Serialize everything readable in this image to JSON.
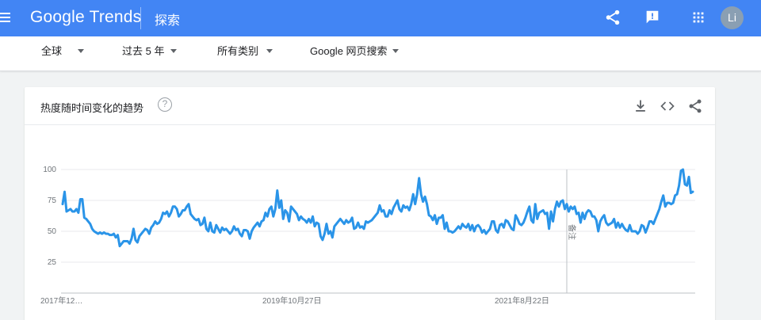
{
  "header": {
    "logo_google": "Google",
    "logo_trends": "Trends",
    "page_title": "探索",
    "avatar_initials": "Li",
    "color": "#4285f4"
  },
  "filters": {
    "region": "全球",
    "time": "过去 5 年",
    "category": "所有类别",
    "search_type": "Google 网页搜索"
  },
  "card": {
    "title": "热度随时间变化的趋势",
    "help_symbol": "?"
  },
  "icons": {
    "menu": "menu-icon",
    "share": "share-icon",
    "feedback": "feedback-icon",
    "apps": "apps-grid-icon",
    "help": "help-icon",
    "download": "download-icon",
    "embed": "embed-icon"
  },
  "chart_data": {
    "type": "line",
    "color": "#2a94e8",
    "ylim": [
      0,
      100
    ],
    "yticks": [
      25,
      50,
      75,
      100
    ],
    "xtick_labels": [
      "2017年12…",
      "2019年10月27日",
      "2021年8月22日"
    ],
    "annotation": "备注",
    "values": [
      72,
      82,
      66,
      67,
      68,
      66,
      66,
      68,
      65,
      76,
      76,
      61,
      60,
      58,
      56,
      52,
      50,
      49,
      48,
      49,
      48,
      49,
      48,
      48,
      47,
      47,
      48,
      45,
      47,
      38,
      40,
      42,
      42,
      42,
      40,
      44,
      52,
      43,
      41,
      46,
      48,
      50,
      52,
      51,
      48,
      53,
      55,
      58,
      56,
      57,
      60,
      65,
      64,
      66,
      62,
      65,
      70,
      70,
      68,
      62,
      64,
      67,
      67,
      70,
      72,
      64,
      62,
      60,
      59,
      60,
      55,
      56,
      61,
      52,
      50,
      57,
      50,
      49,
      55,
      52,
      49,
      53,
      51,
      52,
      50,
      48,
      50,
      54,
      51,
      52,
      48,
      46,
      51,
      51,
      50,
      44,
      50,
      53,
      55,
      57,
      54,
      58,
      59,
      65,
      62,
      68,
      70,
      62,
      68,
      83,
      69,
      75,
      60,
      67,
      65,
      58,
      70,
      68,
      66,
      64,
      59,
      62,
      60,
      59,
      57,
      60,
      57,
      62,
      54,
      57,
      56,
      46,
      43,
      48,
      56,
      48,
      50,
      45,
      54,
      56,
      58,
      60,
      58,
      56,
      59,
      57,
      58,
      61,
      52,
      53,
      57,
      53,
      54,
      52,
      58,
      57,
      58,
      59,
      61,
      63,
      65,
      71,
      66,
      67,
      62,
      62,
      67,
      64,
      69,
      72,
      75,
      68,
      66,
      71,
      69,
      70,
      67,
      72,
      80,
      72,
      80,
      93,
      80,
      74,
      78,
      72,
      63,
      62,
      59,
      63,
      56,
      61,
      61,
      63,
      52,
      57,
      50,
      50,
      49,
      50,
      52,
      54,
      52,
      56,
      54,
      53,
      56,
      51,
      55,
      50,
      54,
      55,
      53,
      49,
      51,
      48,
      50,
      52,
      58,
      58,
      51,
      49,
      55,
      56,
      53,
      59,
      58,
      55,
      52,
      51,
      63,
      60,
      56,
      55,
      57,
      61,
      66,
      70,
      59,
      57,
      72,
      60,
      65,
      66,
      67,
      64,
      65,
      52,
      66,
      58,
      68,
      74,
      70,
      74,
      75,
      68,
      72,
      66,
      70,
      68,
      70,
      64,
      65,
      57,
      65,
      60,
      65,
      67,
      66,
      62,
      62,
      59,
      50,
      58,
      61,
      63,
      57,
      55,
      56,
      57,
      60,
      53,
      57,
      53,
      56,
      53,
      51,
      50,
      55,
      50,
      50,
      50,
      48,
      50,
      55,
      54,
      49,
      53,
      58,
      58,
      56,
      60,
      64,
      68,
      74,
      79,
      70,
      73,
      73,
      72,
      73,
      79,
      80,
      87,
      99,
      100,
      88,
      87,
      94,
      81,
      82
    ]
  }
}
